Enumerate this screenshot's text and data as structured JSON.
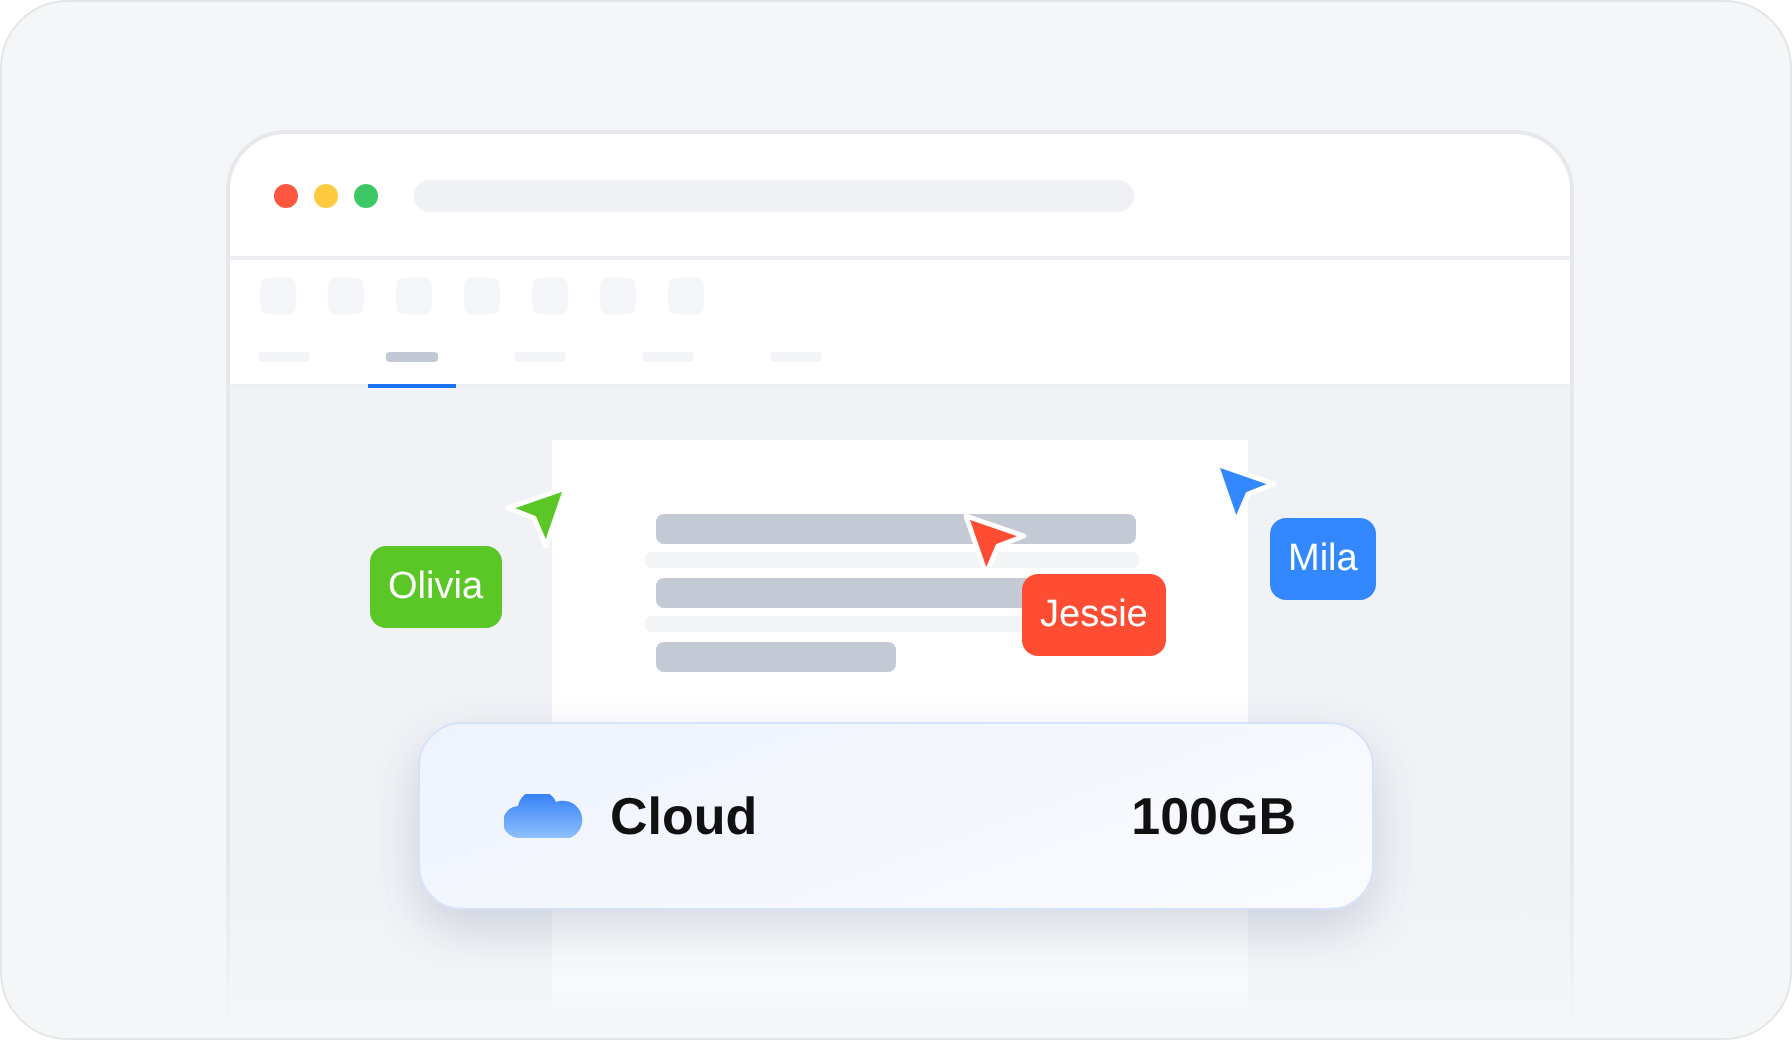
{
  "tabs": [
    {
      "selected": false
    },
    {
      "selected": true
    },
    {
      "selected": false
    },
    {
      "selected": false
    },
    {
      "selected": false
    }
  ],
  "cursors": [
    {
      "name": "Olivia",
      "color": "#5ac726"
    },
    {
      "name": "Jessie",
      "color": "#ff4d33"
    },
    {
      "name": "Mila",
      "color": "#3388ff"
    }
  ],
  "storage": {
    "label": "Cloud",
    "size": "100GB"
  }
}
